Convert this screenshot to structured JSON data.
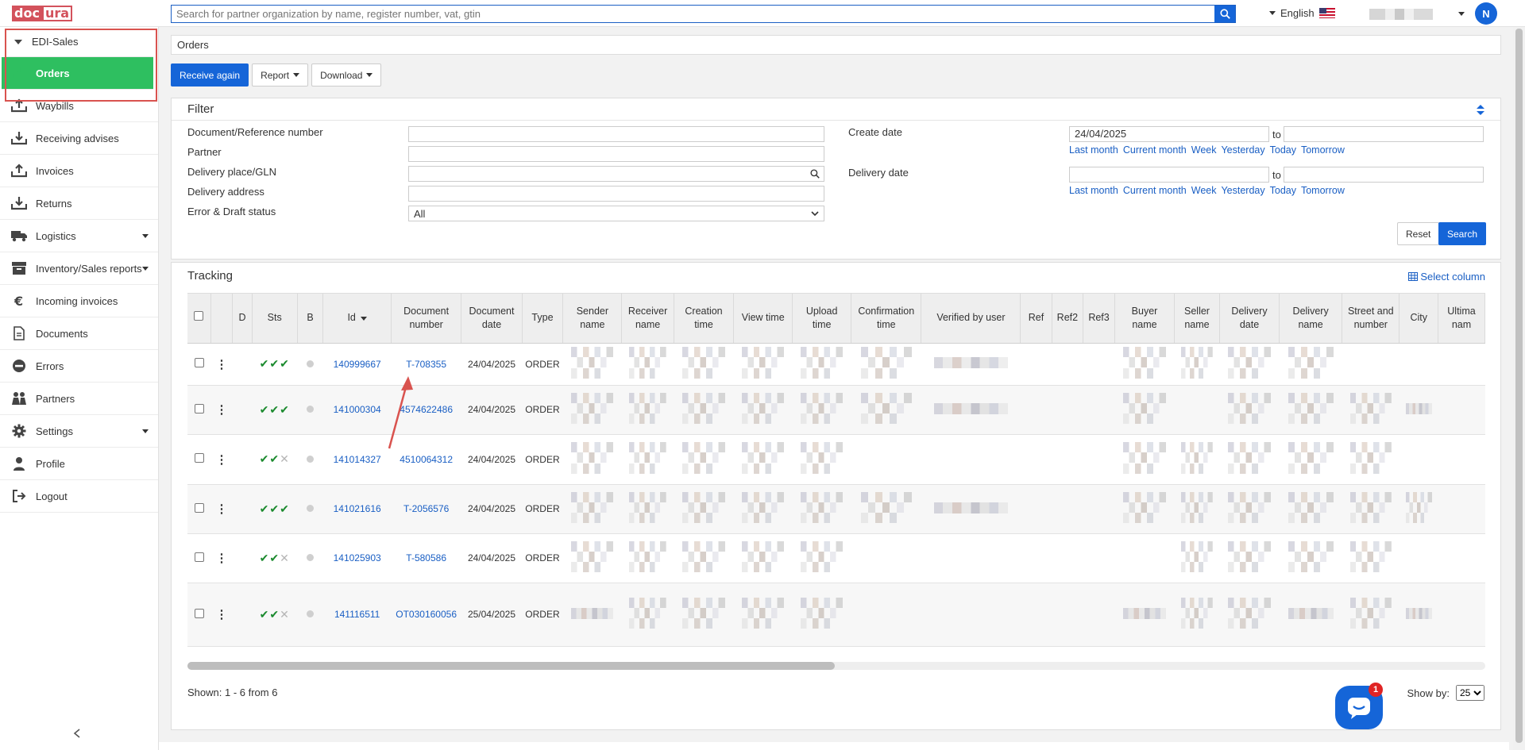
{
  "header": {
    "logo_left": "doc",
    "logo_right": "ura",
    "search_placeholder": "Search for partner organization by name, register number, vat, gtin",
    "language": "English",
    "avatar_initial": "N"
  },
  "sidebar": {
    "section": "EDI-Sales",
    "items": [
      {
        "label": "Orders",
        "icon": "inbox-download-icon",
        "active": true
      },
      {
        "label": "Waybills",
        "icon": "upload-icon"
      },
      {
        "label": "Receiving advises",
        "icon": "inbox-download-icon"
      },
      {
        "label": "Invoices",
        "icon": "upload-icon"
      },
      {
        "label": "Returns",
        "icon": "inbox-download-icon"
      },
      {
        "label": "Logistics",
        "icon": "truck-icon",
        "submenu": true
      },
      {
        "label": "Inventory/Sales reports",
        "icon": "box-icon",
        "submenu": true
      },
      {
        "label": "Incoming invoices",
        "icon": "euro-icon"
      },
      {
        "label": "Documents",
        "icon": "document-icon"
      },
      {
        "label": "Errors",
        "icon": "minus-circle-icon"
      },
      {
        "label": "Partners",
        "icon": "people-icon"
      },
      {
        "label": "Settings",
        "icon": "gear-icon",
        "submenu": true
      },
      {
        "label": "Profile",
        "icon": "person-icon"
      },
      {
        "label": "Logout",
        "icon": "logout-icon"
      }
    ]
  },
  "breadcrumb": "Orders",
  "toolbar": {
    "receive_again": "Receive again",
    "report": "Report",
    "download": "Download"
  },
  "filter": {
    "title": "Filter",
    "document_reference": "Document/Reference number",
    "partner": "Partner",
    "delivery_place": "Delivery place/GLN",
    "delivery_address": "Delivery address",
    "error_draft_status": "Error & Draft status",
    "status_value": "All",
    "create_date": "Create date",
    "create_date_from": "24/04/2025",
    "to": "to",
    "delivery_date": "Delivery date",
    "quick_ranges": [
      "Last month",
      "Current month",
      "Week",
      "Yesterday",
      "Today",
      "Tomorrow"
    ],
    "reset": "Reset",
    "search": "Search"
  },
  "tracking": {
    "title": "Tracking",
    "select_column": "Select column",
    "columns": [
      "D",
      "Sts",
      "B",
      "Id",
      "Document number",
      "Document date",
      "Type",
      "Sender name",
      "Receiver name",
      "Creation time",
      "View time",
      "Upload time",
      "Confirmation time",
      "Verified by user",
      "Ref",
      "Ref2",
      "Ref3",
      "Buyer name",
      "Seller name",
      "Delivery date",
      "Delivery name",
      "Street and number",
      "City",
      "Ultima nam"
    ],
    "rows": [
      {
        "id": "140999667",
        "doc": "T-708355",
        "date": "24/04/2025",
        "type": "ORDER",
        "sts": [
          "ok",
          "ok",
          "ok"
        ]
      },
      {
        "id": "141000304",
        "doc": "4574622486",
        "date": "24/04/2025",
        "type": "ORDER",
        "sts": [
          "ok",
          "ok",
          "ok"
        ]
      },
      {
        "id": "141014327",
        "doc": "4510064312",
        "date": "24/04/2025",
        "type": "ORDER",
        "sts": [
          "ok",
          "ok",
          "x"
        ]
      },
      {
        "id": "141021616",
        "doc": "T-2056576",
        "date": "24/04/2025",
        "type": "ORDER",
        "sts": [
          "ok",
          "ok",
          "ok"
        ]
      },
      {
        "id": "141025903",
        "doc": "T-580586",
        "date": "24/04/2025",
        "type": "ORDER",
        "sts": [
          "ok",
          "ok",
          "x"
        ]
      },
      {
        "id": "141116511",
        "doc": "OT030160056",
        "date": "25/04/2025",
        "type": "ORDER",
        "sts": [
          "ok",
          "ok",
          "x"
        ]
      }
    ],
    "shown": "Shown: 1 - 6 from 6",
    "show_by_label": "Show by:",
    "show_by_value": "25"
  },
  "chat_badge": "1"
}
